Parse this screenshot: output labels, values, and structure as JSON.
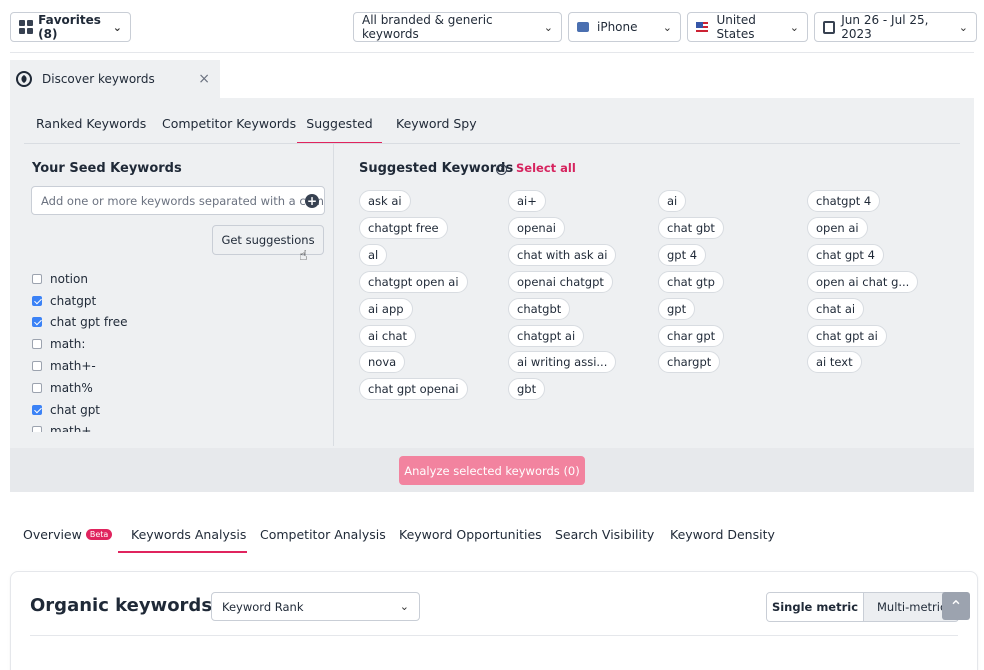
{
  "topbar": {
    "favorites_label": "Favorites (8)",
    "keyword_type": "All branded & generic keywords",
    "device": "iPhone",
    "country": "United States",
    "date_range": "Jun 26 - Jul 25, 2023"
  },
  "discover": {
    "tab_label": "Discover keywords",
    "close_symbol": "×",
    "subtabs": [
      "Ranked Keywords",
      "Competitor Keywords",
      "Suggested",
      "Keyword Spy"
    ],
    "active_subtab": "Suggested"
  },
  "seed": {
    "title": "Your Seed Keywords",
    "input_placeholder": "Add one or more keywords separated with a comma",
    "get_suggestions_label": "Get suggestions",
    "items": [
      {
        "label": "notion",
        "checked": false
      },
      {
        "label": "chatgpt",
        "checked": true
      },
      {
        "label": "chat gpt free",
        "checked": true
      },
      {
        "label": "math:",
        "checked": false
      },
      {
        "label": "math+-",
        "checked": false
      },
      {
        "label": "math%",
        "checked": false
      },
      {
        "label": "chat gpt",
        "checked": true
      },
      {
        "label": "math+",
        "checked": false
      }
    ]
  },
  "suggested": {
    "title": "Suggested Keywords",
    "select_all_label": "Select all",
    "columns": [
      [
        "ask ai",
        "chatgpt free",
        "al",
        "chatgpt open ai",
        "ai app",
        "ai chat",
        "nova",
        "chat gpt openai"
      ],
      [
        "ai+",
        "openai",
        "chat with ask ai",
        "openai chatgpt",
        "chatgbt",
        "chatgpt ai",
        "ai writing assi...",
        "gbt"
      ],
      [
        "ai",
        "chat gbt",
        "gpt 4",
        "chat gtp",
        "gpt",
        "char gpt",
        "chargpt"
      ],
      [
        "chatgpt 4",
        "open ai",
        "chat gpt 4",
        "open ai chat g...",
        "chat ai",
        "chat gpt ai",
        "ai text"
      ]
    ]
  },
  "analyze_label": "Analyze selected keywords (0)",
  "bottom_nav": {
    "items": [
      "Overview",
      "Keywords Analysis",
      "Competitor Analysis",
      "Keyword Opportunities",
      "Search Visibility",
      "Keyword Density"
    ],
    "beta_label": "Beta",
    "active": "Keywords Analysis"
  },
  "organic": {
    "title": "Organic keywords by",
    "metric_select": "Keyword Rank",
    "single_metric": "Single metric",
    "multi_metric": "Multi-metric"
  },
  "colors": {
    "accent": "#e0245e",
    "panel_bg": "#eef0f2",
    "checkbox": "#3b82f6",
    "analyze_button": "#f2839f"
  }
}
